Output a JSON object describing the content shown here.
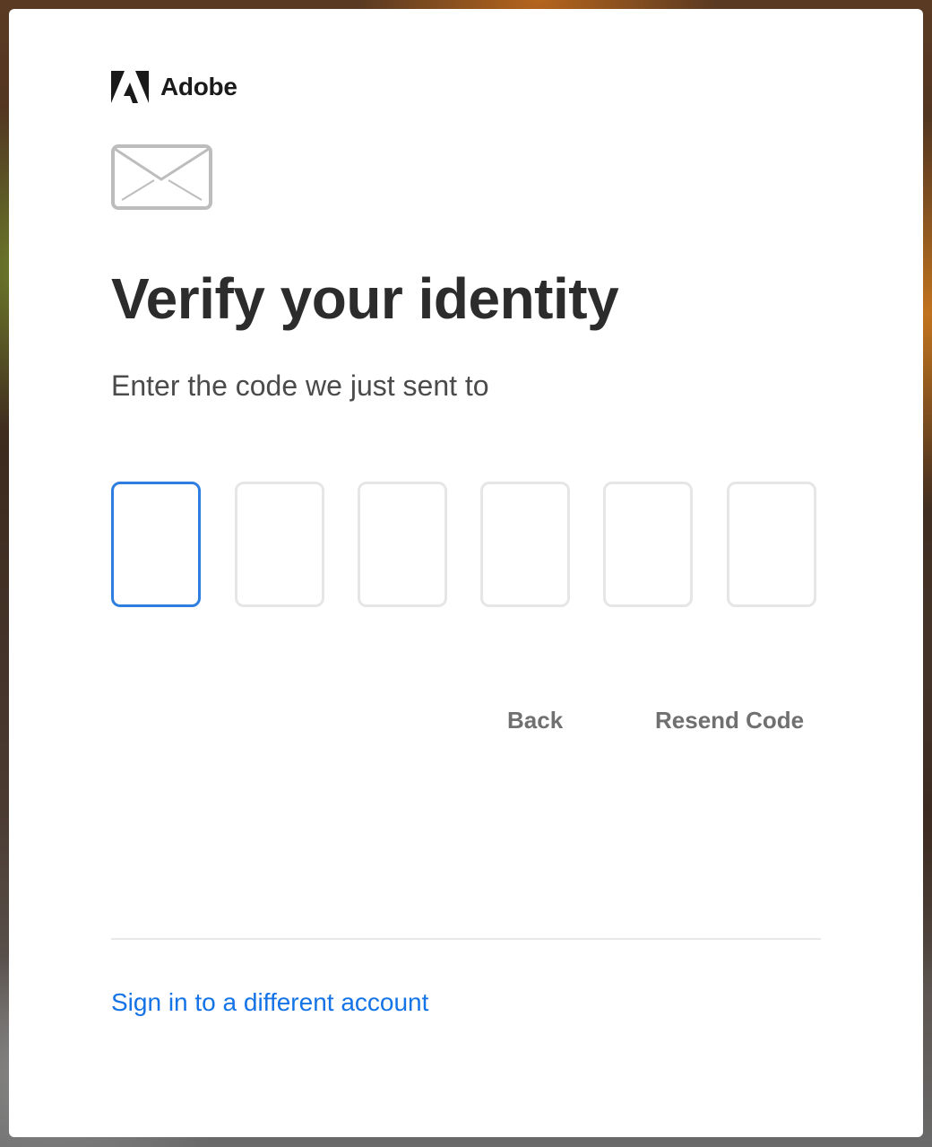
{
  "brand": {
    "name": "Adobe",
    "logo_icon": "adobe-a-icon",
    "accent_color": "#1473e6"
  },
  "header_icon": "envelope-icon",
  "title": "Verify your identity",
  "subtitle": "Enter the code we just sent to",
  "code_input": {
    "length": 6,
    "values": [
      "",
      "",
      "",
      "",
      "",
      ""
    ],
    "active_index": 0,
    "active_border_color": "#2d7ee0"
  },
  "actions": {
    "back_label": "Back",
    "resend_label": "Resend Code"
  },
  "footer": {
    "alt_account_link": "Sign in to a different account"
  }
}
